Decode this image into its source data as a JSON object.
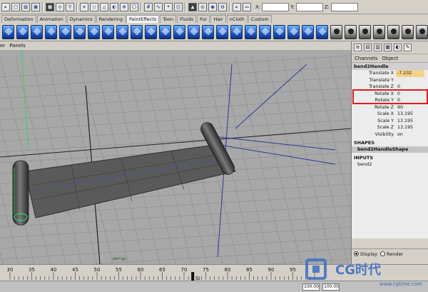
{
  "shelf_tabs": [
    "Deformation",
    "Animation",
    "Dynamics",
    "Rendering",
    "PaintEffects",
    "Toon",
    "Fluids",
    "Fur",
    "Hair",
    "nCloth",
    "Custom"
  ],
  "shelf_active_tab": "PaintEffects",
  "xyz": {
    "x": "X:",
    "y": "Y:",
    "z": "Z:"
  },
  "panel_menu": [
    "er",
    "Panels"
  ],
  "camera_label": "persp",
  "channel_box": {
    "menu": [
      "Channels",
      "Object"
    ],
    "node": "bend2Handle",
    "attributes": [
      {
        "name": "Translate X",
        "value": "-7.232",
        "highlighted": true
      },
      {
        "name": "Translate Y",
        "value": "",
        "highlighted": false
      },
      {
        "name": "Translate Z",
        "value": "0",
        "highlighted": false
      },
      {
        "name": "Rotate X",
        "value": "0",
        "highlighted": false
      },
      {
        "name": "Rotate Y",
        "value": "0",
        "highlighted": false
      },
      {
        "name": "Rotate Z",
        "value": "90",
        "highlighted": false
      },
      {
        "name": "Scale X",
        "value": "13.195",
        "highlighted": false
      },
      {
        "name": "Scale Y",
        "value": "13.195",
        "highlighted": false
      },
      {
        "name": "Scale Z",
        "value": "13.195",
        "highlighted": false
      },
      {
        "name": "Visibility",
        "value": "on",
        "highlighted": false
      }
    ],
    "shapes_label": "SHAPES",
    "shape_item": "bend2HandleShape",
    "inputs_label": "INPUTS",
    "input_item": "bend2",
    "layer_tabs": {
      "display": "Display",
      "render": "Render"
    }
  },
  "timeline": {
    "ticks": [
      "30",
      "35",
      "40",
      "45",
      "50",
      "55",
      "60",
      "65",
      "70",
      "75",
      "80",
      "85",
      "90",
      "95"
    ],
    "current_frame": "72"
  },
  "range": {
    "start": "100.00",
    "end": "100.00"
  },
  "watermark": {
    "brand": "CG时代",
    "url": "www.cgtime.com"
  },
  "colors": {
    "highlight": "#e01b1b",
    "value_highlight": "#f5d28a",
    "handle_green": "#31d36a"
  }
}
